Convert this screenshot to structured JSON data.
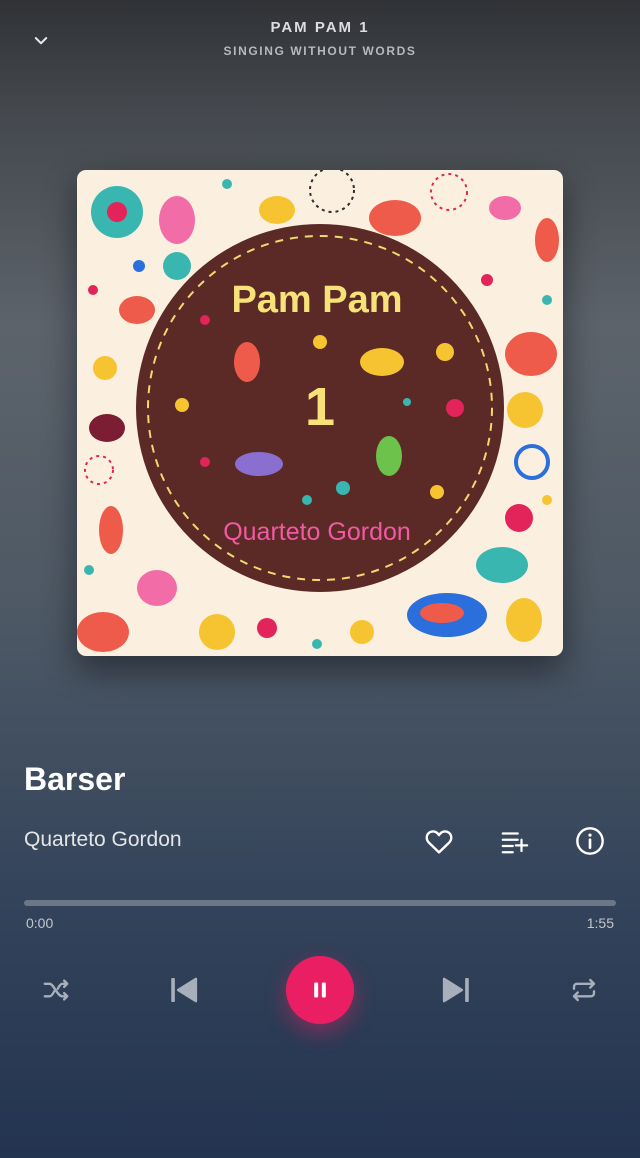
{
  "header": {
    "album_title": "PAM PAM 1",
    "album_subtitle": "SINGING WITHOUT WORDS",
    "collapse_icon": "chevron-down-icon"
  },
  "cover": {
    "title_text": "Pam Pam",
    "number_text": "1",
    "artist_text": "Quarteto Gordon"
  },
  "track": {
    "title": "Barser",
    "artist": "Quarteto Gordon"
  },
  "actions": {
    "favorite_icon": "heart-icon",
    "queue_icon": "playlist-add-icon",
    "info_icon": "info-icon"
  },
  "progress": {
    "current_time": "0:00",
    "total_time": "1:55",
    "fraction": 0
  },
  "controls": {
    "shuffle_icon": "shuffle-icon",
    "previous_icon": "skip-previous-icon",
    "play_state_icon": "pause-icon",
    "next_icon": "skip-next-icon",
    "repeat_icon": "repeat-icon"
  },
  "colors": {
    "accent": "#ea1f63",
    "cover_background": "#fbf0e0",
    "cover_disc": "#5b2a26",
    "cover_title": "#f7e27a",
    "cover_artist": "#ef5aa3"
  }
}
